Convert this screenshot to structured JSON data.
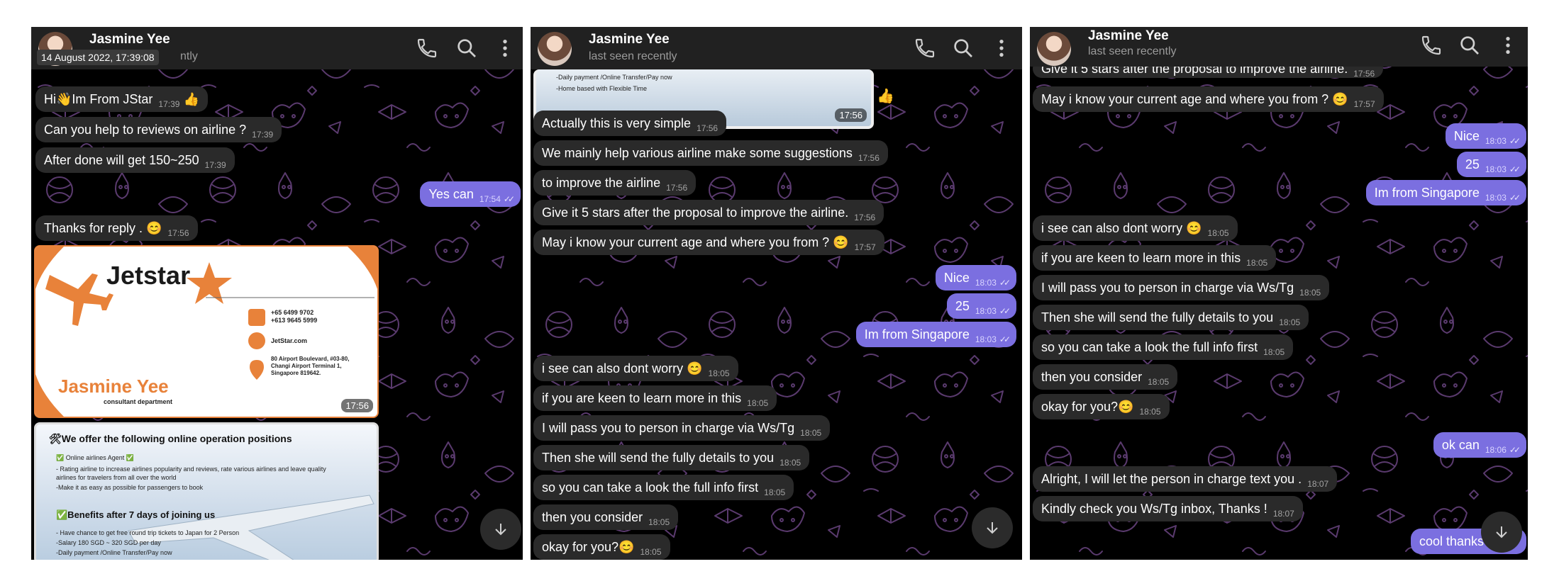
{
  "contact": {
    "name": "Jasmine Yee",
    "status": "last seen recently",
    "status_partial": "ntly"
  },
  "date_chip": "14 August 2022, 17:39:08",
  "colors": {
    "outgoing": "#7b6fe0",
    "incoming": "#2a2a2a",
    "header": "#212121",
    "background": "#000000",
    "doodle": "#5a3a6e"
  },
  "icons": [
    "phone-icon",
    "search-icon",
    "more-vert-icon",
    "arrow-down-icon",
    "double-check-icon"
  ],
  "panel1": {
    "messages": [
      {
        "text": "Hi👋Im From JStar",
        "time": "17:39",
        "extra": "👍"
      },
      {
        "text": "Can you help to reviews on airline ?",
        "time": "17:39"
      },
      {
        "text": "After done will get 150~250",
        "time": "17:39"
      },
      {
        "text": "Yes can",
        "time": "17:54"
      },
      {
        "text": "Thanks for reply . 😊",
        "time": "17:56"
      }
    ],
    "card": {
      "brand": "Jetstar",
      "phones": "+65 6499 9702\n+613 9645 5999",
      "web": "JetStar.com",
      "address": "80 Airport Boulevard, #03-80, Changi Airport Terminal 1, Singapore 819642.",
      "name": "Jasmine Yee",
      "dept": "consultant department",
      "time": "17:56"
    },
    "offer": {
      "title": "🛠We offer the following online operation positions",
      "line1": "✅ Online airlines Agent  ✅",
      "line2": "- Rating airline to increase airlines popularity and reviews, rate various airlines and leave quality",
      "line3": "airlines for travelers from all over the world",
      "line4": "-Make it as easy as possible for passengers to book",
      "benefits_title": "✅Benefits after 7 days of joining us",
      "b1": "- Have chance to get free round trip tickets to Japan for 2 Person",
      "b2": "-Salary 180 SGD ~ 320 SGD per day",
      "b3": "-Daily payment /Online Transfer/Pay now"
    }
  },
  "panel2": {
    "top_image": {
      "line1": "-Daily payment /Online Transfer/Pay now",
      "line2": "-Home based with Flexible Time",
      "time": "17:56",
      "reaction": "👍"
    },
    "messages": [
      {
        "text": "Actually this is very simple",
        "time": "17:56"
      },
      {
        "text": "We mainly help various airline make some suggestions",
        "time": "17:56"
      },
      {
        "text": "to improve the airline",
        "time": "17:56"
      },
      {
        "text": "Give it 5 stars after the proposal to improve the airline.",
        "time": "17:56"
      },
      {
        "text": "May i know your current age and where you from ? 😊",
        "time": "17:57"
      },
      {
        "text": "Nice",
        "time": "18:03"
      },
      {
        "text": "25",
        "time": "18:03"
      },
      {
        "text": "Im from Singapore",
        "time": "18:03"
      },
      {
        "text": "i see can also dont worry 😊",
        "time": "18:05"
      },
      {
        "text": "if you are keen to learn more in this",
        "time": "18:05"
      },
      {
        "text": "I will pass you to person in charge via Ws/Tg",
        "time": "18:05"
      },
      {
        "text": "Then she will send the fully details to you",
        "time": "18:05"
      },
      {
        "text": "so you can take a look the full info first",
        "time": "18:05"
      },
      {
        "text": "then you consider",
        "time": "18:05"
      },
      {
        "text": "okay for you?😊",
        "time": "18:05"
      }
    ]
  },
  "panel3": {
    "messages": [
      {
        "text": "Give it 5 stars after the proposal to improve the airline.",
        "time": "17:56"
      },
      {
        "text": "May i know your current age and where you from ? 😊",
        "time": "17:57"
      },
      {
        "text": "Nice",
        "time": "18:03"
      },
      {
        "text": "25",
        "time": "18:03"
      },
      {
        "text": "Im from Singapore",
        "time": "18:03"
      },
      {
        "text": "i see can also dont worry 😊",
        "time": "18:05"
      },
      {
        "text": "if you are keen to learn more in this",
        "time": "18:05"
      },
      {
        "text": "I will pass you to person in charge via Ws/Tg",
        "time": "18:05"
      },
      {
        "text": "Then she will send the fully details to you",
        "time": "18:05"
      },
      {
        "text": "so you can take a look the full info first",
        "time": "18:05"
      },
      {
        "text": "then you consider",
        "time": "18:05"
      },
      {
        "text": "okay for you?😊",
        "time": "18:05"
      },
      {
        "text": "ok can",
        "time": "18:06"
      },
      {
        "text": "Alright, I will let the person in charge text you .",
        "time": "18:07"
      },
      {
        "text": "Kindly check you Ws/Tg inbox, Thanks !",
        "time": "18:07"
      },
      {
        "text": "cool thanks",
        "time": ""
      }
    ]
  }
}
